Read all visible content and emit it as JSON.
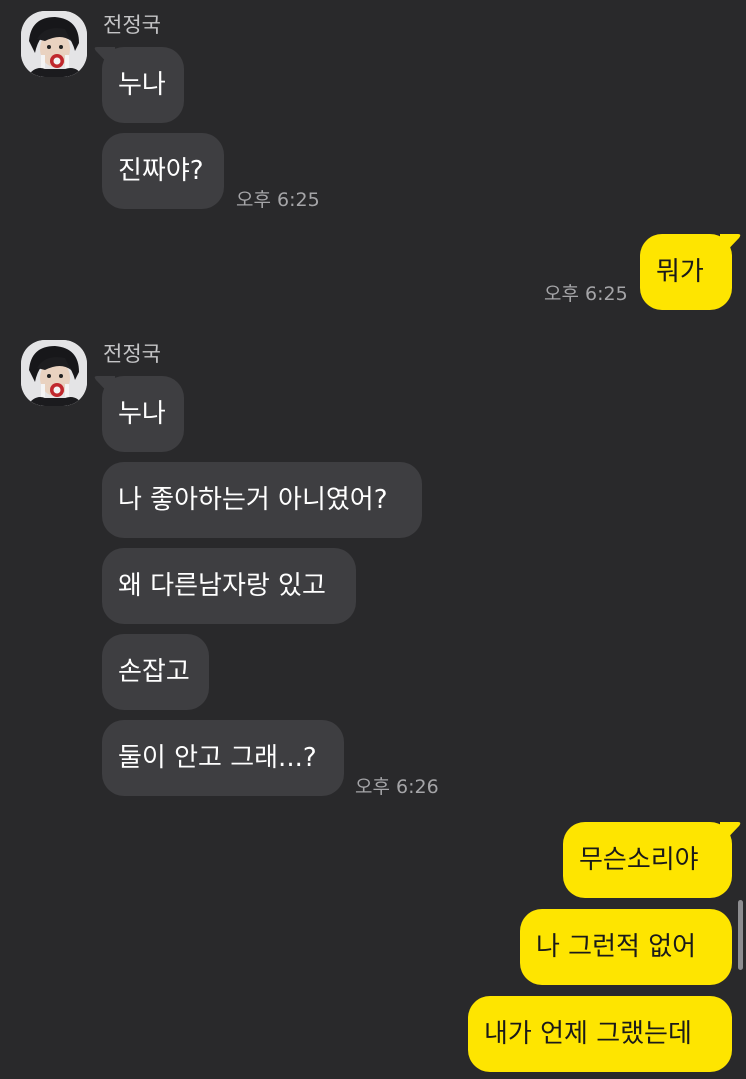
{
  "chat": {
    "groups": [
      {
        "sender": "전정국",
        "messages": [
          "누나",
          "진짜야?"
        ],
        "time": "오후 6:25"
      },
      {
        "sender": "전정국",
        "messages": [
          "누나",
          "나 좋아하는거 아니였어?",
          "왜 다른남자랑 있고",
          "손잡고",
          "둘이 안고 그래...?"
        ],
        "time": "오후 6:26"
      }
    ],
    "my_messages": [
      {
        "text": "뭐가",
        "time": "오후 6:25"
      },
      {
        "text": "무슨소리야"
      },
      {
        "text": "나 그런적 없어"
      },
      {
        "text": "내가 언제 그랬는데"
      }
    ]
  },
  "colors": {
    "background": "#29292b",
    "incoming_bubble": "#3e3e41",
    "outgoing_bubble": "#fee500",
    "timestamp": "#a5a5a8"
  }
}
